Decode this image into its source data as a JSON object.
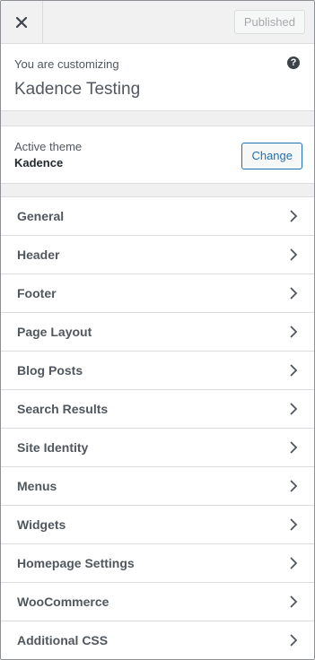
{
  "header": {
    "close_icon": "close-icon",
    "publish_label": "Published"
  },
  "info": {
    "customizing_label": "You are customizing",
    "site_title": "Kadence Testing",
    "help_icon_glyph": "?"
  },
  "theme": {
    "label": "Active theme",
    "name": "Kadence",
    "change_label": "Change"
  },
  "sections": [
    {
      "label": "General"
    },
    {
      "label": "Header"
    },
    {
      "label": "Footer"
    },
    {
      "label": "Page Layout"
    },
    {
      "label": "Blog Posts"
    },
    {
      "label": "Search Results"
    },
    {
      "label": "Site Identity"
    },
    {
      "label": "Menus"
    },
    {
      "label": "Widgets"
    },
    {
      "label": "Homepage Settings"
    },
    {
      "label": "WooCommerce"
    },
    {
      "label": "Additional CSS"
    }
  ],
  "colors": {
    "accent": "#2271b1",
    "border": "#dcdcde",
    "panel_bg": "#f0f0f1"
  }
}
